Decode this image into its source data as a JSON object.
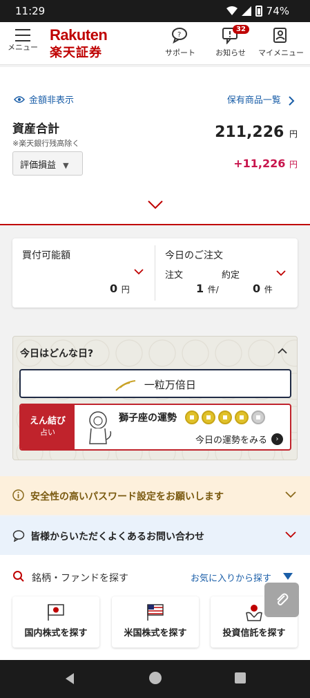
{
  "status_bar": {
    "time": "11:29",
    "battery": "74%"
  },
  "header": {
    "menu_label": "メニュー",
    "logo_en": "Rakuten",
    "logo_jp": "楽天証券",
    "support_label": "サポート",
    "notice_label": "お知らせ",
    "notice_badge": "32",
    "mymenu_label": "マイメニュー"
  },
  "assets": {
    "hide_amount_label": "金額非表示",
    "holdings_link": "保有商品一覧",
    "title": "資産合計",
    "note": "※楽天銀行残高除く",
    "total_value": "211,226",
    "currency": "円",
    "pl_selector": "評価損益",
    "pl_value": "+11,226"
  },
  "orders": {
    "buying_power_label": "買付可能額",
    "buying_power_value": "0",
    "today_orders_label": "今日のご注文",
    "order_label": "注文",
    "executed_label": "約定",
    "order_count": "1",
    "executed_count": "0",
    "count_unit": "件",
    "count_unit_slash": "件/",
    "currency": "円"
  },
  "today": {
    "title": "今日はどんな日?",
    "lucky_day": "一粒万倍日",
    "fortune_tag_main": "えん結び",
    "fortune_tag_sub": "占い",
    "fortune_title": "獅子座の運勢",
    "fortune_link": "今日の運勢をみる",
    "fortune_level": 4,
    "fortune_max": 5
  },
  "notices": {
    "password": "安全性の高いパスワード設定をお願いします",
    "faq": "皆様からいただくよくあるお問い合わせ"
  },
  "search": {
    "label": "銘柄・ファンドを探す",
    "favorites_link": "お気に入りから探す",
    "categories": [
      {
        "label": "国内株式を探す",
        "icon": "japan-flag-icon"
      },
      {
        "label": "米国株式を探す",
        "icon": "us-flag-icon"
      },
      {
        "label": "投資信託を探す",
        "icon": "fund-icon"
      }
    ]
  },
  "colors": {
    "brand": "#bf0000",
    "link": "#1a5ea8",
    "gain": "#c8144c"
  }
}
